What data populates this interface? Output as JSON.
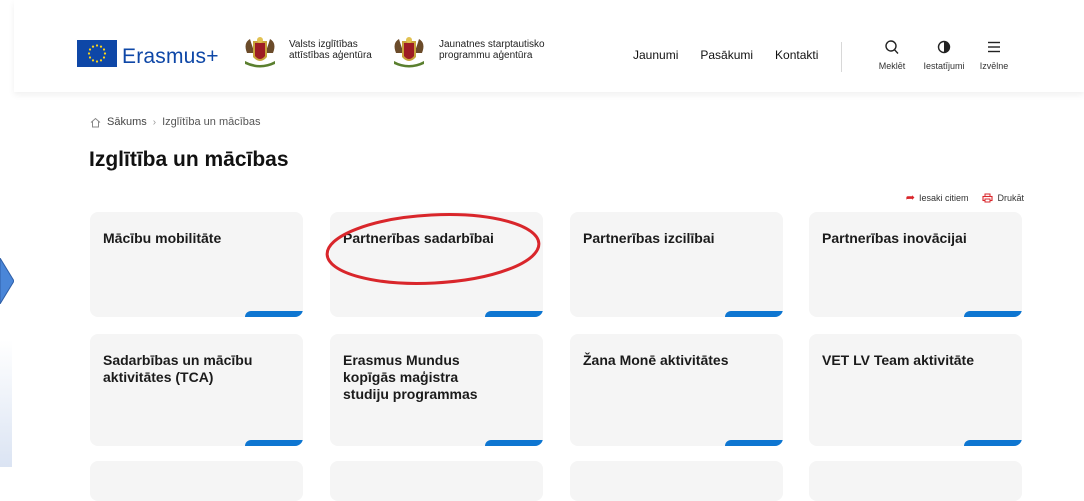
{
  "header": {
    "brand": "Erasmus+",
    "agency1": [
      "Valsts izglītības",
      "attīstības aģentūra"
    ],
    "agency2": [
      "Jaunatnes starptautisko",
      "programmu aģentūra"
    ],
    "nav": [
      "Jaunumi",
      "Pasākumi",
      "Kontakti"
    ],
    "tools": [
      {
        "label": "Meklēt",
        "icon": "search-icon"
      },
      {
        "label": "Iestatījumi",
        "icon": "contrast-icon"
      },
      {
        "label": "Izvēlne",
        "icon": "menu-icon"
      }
    ]
  },
  "breadcrumb": {
    "home": "Sākums",
    "current": "Izglītība un mācības"
  },
  "page": {
    "title": "Izglītība un mācības"
  },
  "share": {
    "recommend": "Iesaki citiem",
    "print": "Drukāt"
  },
  "cards": [
    {
      "label": "Mācību mobilitāte"
    },
    {
      "label": "Partnerības sadarbībai",
      "highlighted": true
    },
    {
      "label": "Partnerības izcilībai"
    },
    {
      "label": "Partnerības inovācijai"
    },
    {
      "label": "Sadarbības un mācību aktivitātes (TCA)"
    },
    {
      "label": "Erasmus Mundus kopīgās maģistra studiju programmas"
    },
    {
      "label": "Žana Monē aktivitātes"
    },
    {
      "label": "VET LV Team aktivitāte"
    }
  ],
  "colors": {
    "brand": "#0e47a7",
    "accent": "#0e76d1",
    "annotation": "#d9262b",
    "card_bg": "#f5f5f5"
  }
}
